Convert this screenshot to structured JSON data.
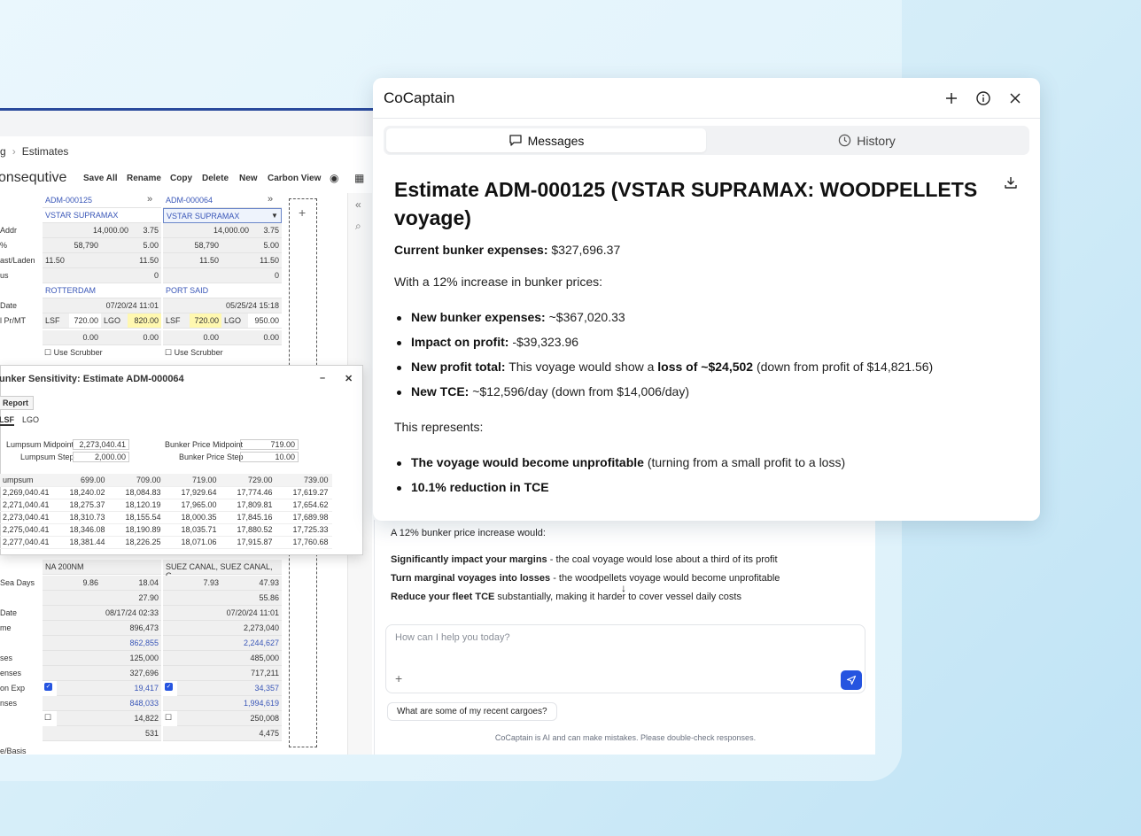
{
  "app": {
    "breadcrumb": [
      "g",
      "Estimates"
    ],
    "title": "onsequtive",
    "toolbar": [
      "Save All",
      "Rename",
      "Copy",
      "Delete",
      "New",
      "Carbon View"
    ],
    "estimate_a": "ADM-000125",
    "estimate_b": "ADM-000064",
    "vessel_a": "VSTAR SUPRAMAX",
    "vessel_b": "VSTAR SUPRAMAX",
    "rows": [
      {
        "label": "Addr",
        "a1": "14,000.00",
        "a2": "3.75",
        "b1": "14,000.00",
        "b2": "3.75"
      },
      {
        "label": "%",
        "a1": "58,790",
        "a2": "5.00",
        "b1": "58,790",
        "b2": "5.00"
      },
      {
        "label": "ast/Laden",
        "a1": "11.50",
        "a2": "11.50",
        "b1": "11.50",
        "b2": "11.50"
      },
      {
        "label": "us",
        "a1": "",
        "a2": "0",
        "b1": "",
        "b2": "0"
      }
    ],
    "port_a": "ROTTERDAM",
    "port_b": "PORT SAID",
    "date_label": "Date",
    "date_a": "07/20/24 11:01",
    "date_b": "05/25/24 15:18",
    "fuel_label": "l Pr/MT",
    "fuel_a": [
      "LSF",
      "720.00",
      "LGO",
      "820.00"
    ],
    "fuel_b": [
      "LSF",
      "720.00",
      "LGO",
      "950.00"
    ],
    "zero_a": [
      "0.00",
      "0.00"
    ],
    "zero_b": [
      "0.00",
      "0.00"
    ],
    "scrubber": "Use Scrubber"
  },
  "bunker": {
    "title": "unker Sensitivity: Estimate ADM-000064",
    "report": "Report",
    "tabs": [
      "LSF",
      "LGO"
    ],
    "lumpsum_midpoint_label": "Lumpsum Midpoint",
    "lumpsum_midpoint": "2,273,040.41",
    "lumpsum_step_label": "Lumpsum Step",
    "lumpsum_step": "2,000.00",
    "bunker_midpoint_label": "Bunker Price Midpoint",
    "bunker_midpoint": "719.00",
    "bunker_step_label": "Bunker Price Step",
    "bunker_step": "10.00",
    "header": [
      "umpsum",
      "699.00",
      "709.00",
      "719.00",
      "729.00",
      "739.00"
    ],
    "rows": [
      [
        "2,269,040.41",
        "18,240.02",
        "18,084.83",
        "17,929.64",
        "17,774.46",
        "17,619.27"
      ],
      [
        "2,271,040.41",
        "18,275.37",
        "18,120.19",
        "17,965.00",
        "17,809.81",
        "17,654.62"
      ],
      [
        "2,273,040.41",
        "18,310.73",
        "18,155.54",
        "18,000.35",
        "17,845.16",
        "17,689.98"
      ],
      [
        "2,275,040.41",
        "18,346.08",
        "18,190.89",
        "18,035.71",
        "17,880.52",
        "17,725.33"
      ],
      [
        "2,277,040.41",
        "18,381.44",
        "18,226.25",
        "18,071.06",
        "17,915.87",
        "17,760.68"
      ]
    ]
  },
  "lower": {
    "route_a": "NA 200NM",
    "route_b": "SUEZ CANAL, SUEZ CANAL, G",
    "rows": [
      {
        "label": "Sea Days",
        "a1": "9.86",
        "a2": "18.04",
        "b1": "7.93",
        "b2": "47.93"
      },
      {
        "label": "",
        "a1": "",
        "a2": "27.90",
        "b1": "",
        "b2": "55.86"
      },
      {
        "label": "Date",
        "a1": "",
        "a2": "08/17/24 02:33",
        "b1": "",
        "b2": "07/20/24 11:01"
      },
      {
        "label": "me",
        "a1": "",
        "a2": "896,473",
        "b1": "",
        "b2": "2,273,040"
      },
      {
        "label": "",
        "a1": "",
        "a2": "862,855",
        "b1": "",
        "b2": "2,244,627"
      },
      {
        "label": "ses",
        "a1": "",
        "a2": "125,000",
        "b1": "",
        "b2": "485,000"
      },
      {
        "label": "enses",
        "a1": "",
        "a2": "327,696",
        "b1": "",
        "b2": "717,211"
      },
      {
        "label": "on Exp",
        "a1": "",
        "a2": "19,417",
        "b1": "",
        "b2": "34,357"
      },
      {
        "label": "nses",
        "a1": "",
        "a2": "848,033",
        "b1": "",
        "b2": "1,994,619"
      },
      {
        "label": "",
        "a1": "",
        "a2": "14,822",
        "b1": "",
        "b2": "250,008"
      },
      {
        "label": "",
        "a1": "",
        "a2": "531",
        "b1": "",
        "b2": "4,475"
      },
      {
        "label": "e/Basis",
        "a1": "",
        "a2": "",
        "b1": "",
        "b2": ""
      }
    ]
  },
  "cocaptain": {
    "title": "CoCaptain",
    "tabs": {
      "messages": "Messages",
      "history": "History"
    },
    "heading": "Estimate ADM-000125 (VSTAR SUPRAMAX: WOODPELLETS voyage)",
    "current_label": "Current bunker expenses:",
    "current_value": "$327,696.37",
    "intro": "With a 12% increase in bunker prices:",
    "bullets": [
      {
        "label": "New bunker expenses:",
        "text": "~$367,020.33"
      },
      {
        "label": "Impact on profit:",
        "text": "-$39,323.96"
      },
      {
        "label": "New profit total:",
        "text_pre": "This voyage would show a",
        "strong": "loss of ~$24,502",
        "text_post": "(down from profit of $14,821.56)"
      },
      {
        "label": "New TCE:",
        "text": "~$12,596/day (down from $14,006/day)"
      }
    ],
    "represents": "This represents:",
    "points": [
      {
        "strong": "The voyage would become unprofitable",
        "text": "(turning from a small profit to a loss)"
      },
      {
        "strong": "10.1% reduction in TCE",
        "text": ""
      }
    ]
  },
  "underlay": {
    "lead": "A 12% bunker price increase would:",
    "lines": [
      {
        "strong": "Significantly impact your margins",
        "text": "- the coal voyage would lose about a third of its profit"
      },
      {
        "strong": "Turn marginal voyages into losses",
        "text": "- the woodpellets voyage would become unprofitable"
      },
      {
        "strong": "Reduce your fleet TCE",
        "text": "substantially, making it harder to cover vessel daily costs"
      }
    ],
    "placeholder": "How can I help you today?",
    "suggestion": "What are some of my recent cargoes?",
    "disclaimer": "CoCaptain is AI and can make mistakes. Please double-check responses."
  },
  "colors": {
    "accent": "#2554e0",
    "link": "#3a57b8",
    "highlight": "#fff8b0"
  }
}
